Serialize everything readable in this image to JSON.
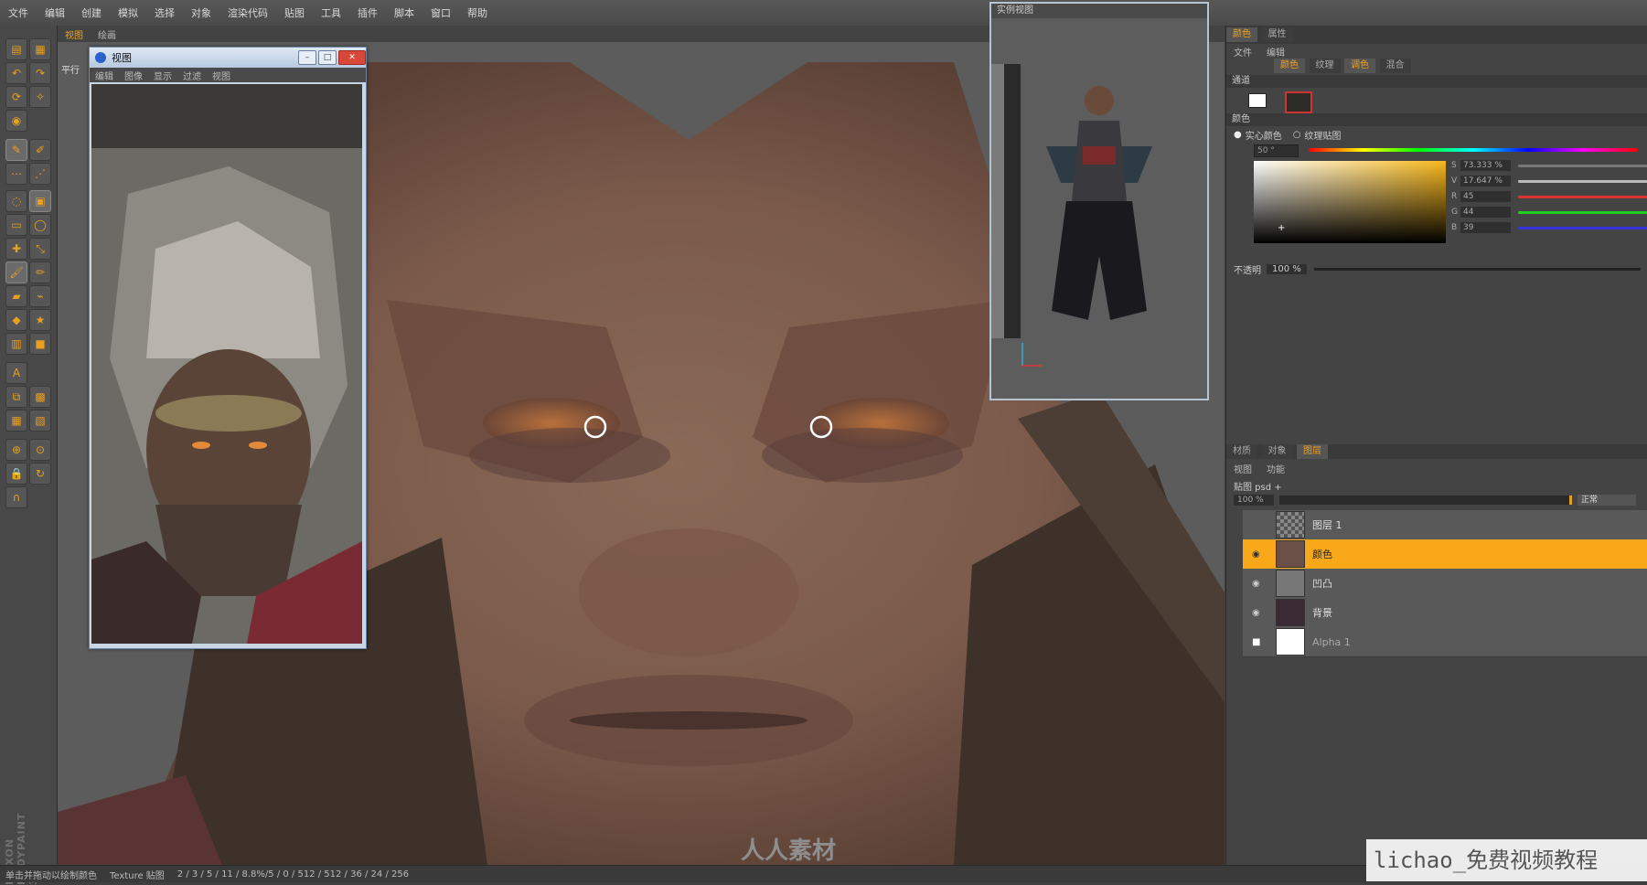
{
  "menu": [
    "文件",
    "编辑",
    "创建",
    "模拟",
    "选择",
    "对象",
    "渲染代码",
    "贴图",
    "工具",
    "插件",
    "脚本",
    "窗口",
    "帮助"
  ],
  "viewport": {
    "tabs": [
      "视图",
      "绘画"
    ],
    "mode_label": "平行"
  },
  "ref_window": {
    "title": "视图",
    "menu": [
      "编辑",
      "图像",
      "显示",
      "过滤",
      "视图"
    ],
    "min": "–",
    "max": "□",
    "close": "✕"
  },
  "model_window": {
    "title": "实例视图"
  },
  "right_panel": {
    "top_tabs": [
      "颜色",
      "属性"
    ],
    "sub_menu": [
      "文件",
      "编辑"
    ],
    "mode_tabs": [
      "颜色",
      "纹理",
      "调色",
      "混合"
    ],
    "section_channel": "通道",
    "section_color": "颜色",
    "color_radio_1": "实心颜色",
    "color_radio_2": "纹理贴图",
    "hue_value": "50 °",
    "fields": [
      {
        "label": "S",
        "value": "73.333 %",
        "color": "#777"
      },
      {
        "label": "V",
        "value": "17.647 %",
        "color": "#bbb"
      },
      {
        "label": "R",
        "value": "45",
        "color": "#d33"
      },
      {
        "label": "G",
        "value": "44",
        "color": "#2c2"
      },
      {
        "label": "B",
        "value": "39",
        "color": "#33d"
      }
    ],
    "opacity_label": "不透明",
    "opacity_value": "100 % ",
    "bottom_tabs": [
      "材质",
      "对象",
      "图层"
    ],
    "layer_menu": [
      "视图",
      "功能"
    ],
    "file_label": "贴图 psd +",
    "layer_opacity": "100 % ",
    "blend_mode": "正常",
    "layers": [
      {
        "name": "图层 1",
        "selected": false
      },
      {
        "name": "颜色",
        "selected": true
      },
      {
        "name": "凹凸",
        "selected": false
      },
      {
        "name": "背景",
        "selected": false
      },
      {
        "name": "Alpha 1",
        "selected": false
      }
    ]
  },
  "status": {
    "hint": "单击并拖动以绘制颜色",
    "texture_label": "Texture 贴图",
    "coords": "2 / 3 / 5 / 11 / 8.8%/5 / 0 / 512 / 512 / 36 / 24 / 256"
  },
  "brand": "MAXON BODYPAINT 3D",
  "logo_text": "人人素材",
  "watermark": "lichao_免费视频教程"
}
